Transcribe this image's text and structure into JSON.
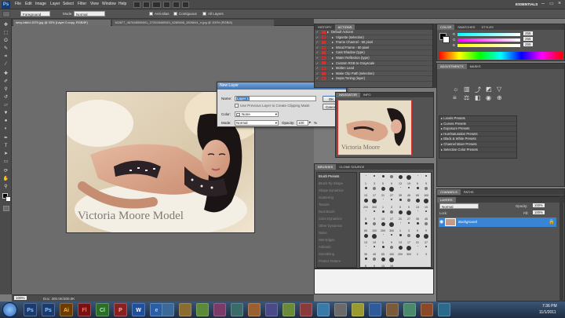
{
  "app": {
    "logo": "Ps"
  },
  "menu": [
    "File",
    "Edit",
    "Image",
    "Layer",
    "Select",
    "Filter",
    "View",
    "Window",
    "Help"
  ],
  "workspace": {
    "name": "ESSENTIALS"
  },
  "options": {
    "preset": "Foreground",
    "mode_label": "Mode:",
    "mode_value": "Normal",
    "antialias": "Anti-alias",
    "contiguous": "Contiguous",
    "all_layers": "All Layers"
  },
  "document_tabs": [
    "sexy-bikini-1970.jpg @ 33% (Layer 0 copy, RGB/8*)",
    "162877_467846596501_272028465501_6280466_2826641_n.jpg @ 100% (RGB/8)"
  ],
  "status": {
    "zoom": "100%",
    "doc": "Doc: 300.0K/300.0K"
  },
  "photo": {
    "watermark": "Victoria Moore Model"
  },
  "dialog": {
    "title": "New Layer",
    "name_label": "Name:",
    "name_value": "Layer 1",
    "clipping_text": "Use Previous Layer to Create Clipping Mask",
    "color_label": "Color:",
    "color_value": "None",
    "mode_label": "Mode:",
    "mode_value": "Normal",
    "opacity_label": "Opacity:",
    "opacity_value": "100",
    "opacity_unit": "%",
    "ok_label": "OK",
    "cancel_label": "Cancel"
  },
  "actions_panel": {
    "tabs": [
      "HISTORY",
      "ACTIONS"
    ],
    "set_name": "Default Actions",
    "items": [
      "Vignette (selection)",
      "Frame Channel - 50 pixel",
      "Wood Frame - 50 pixel",
      "Cast Shadow (type)",
      "Water Reflection (type)",
      "Custom RGB to Grayscale",
      "Molten Lead",
      "Make Clip Path (selection)",
      "Sepia Toning (layer)"
    ]
  },
  "color_panel": {
    "tabs": [
      "COLOR",
      "SWATCHES",
      "STYLES"
    ],
    "channels": [
      "R",
      "G",
      "B"
    ],
    "values": [
      "255",
      "255",
      "255"
    ]
  },
  "adjustments_panel": {
    "tabs": [
      "ADJUSTMENTS",
      "MASKS"
    ],
    "presets": [
      "Levels Presets",
      "Curves Presets",
      "Exposure Presets",
      "Hue/Saturation Presets",
      "Black & White Presets",
      "Channel Mixer Presets",
      "Selective Color Presets"
    ]
  },
  "navigator_panel": {
    "tabs": [
      "NAVIGATOR",
      "INFO"
    ],
    "watermark": "Victoria Moore"
  },
  "brushes_panel": {
    "tabs": [
      "BRUSHES",
      "CLONE SOURCE"
    ],
    "options": [
      "Brush Presets",
      "Brush Tip Shape",
      "Shape Dynamics",
      "Scattering",
      "Texture",
      "Dual Brush",
      "Color Dynamics",
      "Other Dynamics",
      "Noise",
      "Wet Edges",
      "Airbrush",
      "Smoothing",
      "Protect Texture"
    ],
    "sizes": [
      "1",
      "3",
      "5",
      "9",
      "13",
      "19",
      "5",
      "9",
      "13",
      "17",
      "21",
      "27",
      "35",
      "45",
      "65",
      "100",
      "200",
      "300"
    ]
  },
  "channels_tabs": [
    "CHANNELS",
    "PATHS"
  ],
  "layers_panel": {
    "title": "LAYERS",
    "blend_mode": "Normal",
    "opacity_label": "Opacity:",
    "opacity_value": "100%",
    "lock_label": "Lock:",
    "fill_label": "Fill:",
    "fill_value": "100%",
    "layer_name": "Background"
  },
  "taskbar": {
    "icons": [
      "Ps",
      "Ps",
      "Ai",
      "Fl",
      "Cl",
      "P",
      "W",
      "e"
    ],
    "time": "7:36 PM",
    "date": "11/1/2011"
  },
  "colors": {
    "selection": "#3b7fd1",
    "panel": "#535353",
    "dialog": "#dcdcdc",
    "highlight": "#3a84d6"
  }
}
